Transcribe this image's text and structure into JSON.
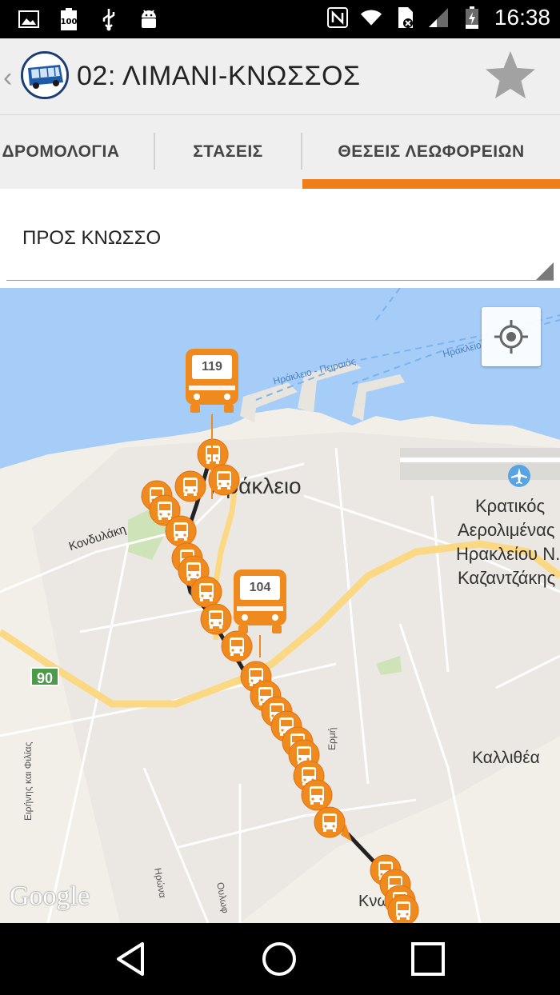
{
  "status_bar": {
    "time": "16:38"
  },
  "action_bar": {
    "title": "02: ΛΙΜΑΝΙ-ΚΝΩΣΣΟΣ",
    "logo": "bus-logo-icon",
    "favorite_icon": "star-icon"
  },
  "tabs": [
    {
      "label": "ΔΡΟΜΟΛΟΓΙΑ",
      "selected": false
    },
    {
      "label": "ΣΤΑΣΕΙΣ",
      "selected": false
    },
    {
      "label": "ΘΕΣΕΙΣ ΛΕΩΦΟΡΕΙΩΝ",
      "selected": true
    }
  ],
  "direction_spinner": {
    "selected": "ΠΡΟΣ ΚΝΩΣΣΟ"
  },
  "map": {
    "labels": {
      "city": "Ηράκλειο",
      "airport_1": "Κρατικός",
      "airport_2": "Αερολιμένας",
      "airport_3": "Ηρακλείου Ν.",
      "airport_4": "Καζαντζάκης",
      "kondylaki": "Κονδυλάκη",
      "kallithea": "Καλλιθέα",
      "ferry_1": "Ηράκλειο - Πειραιάς",
      "ferry_2": "Ηράκλειο",
      "irinis": "Ειρήνης και Φιλίας",
      "erm": "Ερμή",
      "irona": "Ηρώνα",
      "oulof": "Ουλωφ",
      "knossos": "Κνωσός",
      "road_90": "90",
      "google": "Google"
    },
    "bus_markers": [
      {
        "route": "119"
      },
      {
        "route": "104"
      }
    ],
    "accent_color": "#ef8a1f"
  },
  "nav_bar": {
    "back": "back-icon",
    "home": "home-icon",
    "recents": "recents-icon"
  }
}
